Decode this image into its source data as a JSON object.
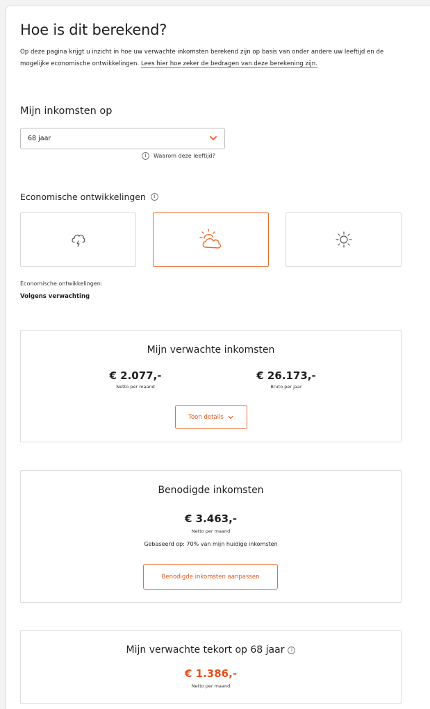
{
  "page": {
    "title": "Hoe is dit berekend?",
    "intro_text": "Op deze pagina krijgt u inzicht in hoe uw verwachte inkomsten berekend zijn op basis van onder andere uw leeftijd en de mogelijke economische ontwikkelingen. ",
    "intro_link": "Lees hier hoe zeker de bedragen van deze berekening zijn."
  },
  "income_at": {
    "label": "Mijn inkomsten op",
    "selected_age": "68 jaar",
    "why_link": "Waarom deze leeftijd?"
  },
  "economic": {
    "label": "Economische ontwikkelingen",
    "options": [
      {
        "icon": "storm-cloud-icon",
        "selected": false
      },
      {
        "icon": "partly-cloudy-icon",
        "selected": true
      },
      {
        "icon": "sun-icon",
        "selected": false
      }
    ],
    "current_label": "Economische ontwikkelingen:",
    "current_value": "Volgens verwachting"
  },
  "expected_income": {
    "title": "Mijn verwachte inkomsten",
    "net_amount": "€ 2.077,-",
    "net_label": "Netto per maand",
    "gross_amount": "€ 26.173,-",
    "gross_label": "Bruto per jaar",
    "details_button": "Toon details"
  },
  "required_income": {
    "title": "Benodigde inkomsten",
    "amount": "€ 3.463,-",
    "amount_label": "Netto per maand",
    "based_on": "Gebaseerd op: 70% van mijn huidige inkomsten",
    "adjust_button": "Benodigde inkomsten aanpassen"
  },
  "shortfall": {
    "title": "Mijn verwachte tekort op 68 jaar",
    "amount": "€ 1.386,-",
    "amount_label": "Netto per maand"
  },
  "colors": {
    "accent": "#ee6b2d",
    "shortfall": "#e3501b"
  }
}
